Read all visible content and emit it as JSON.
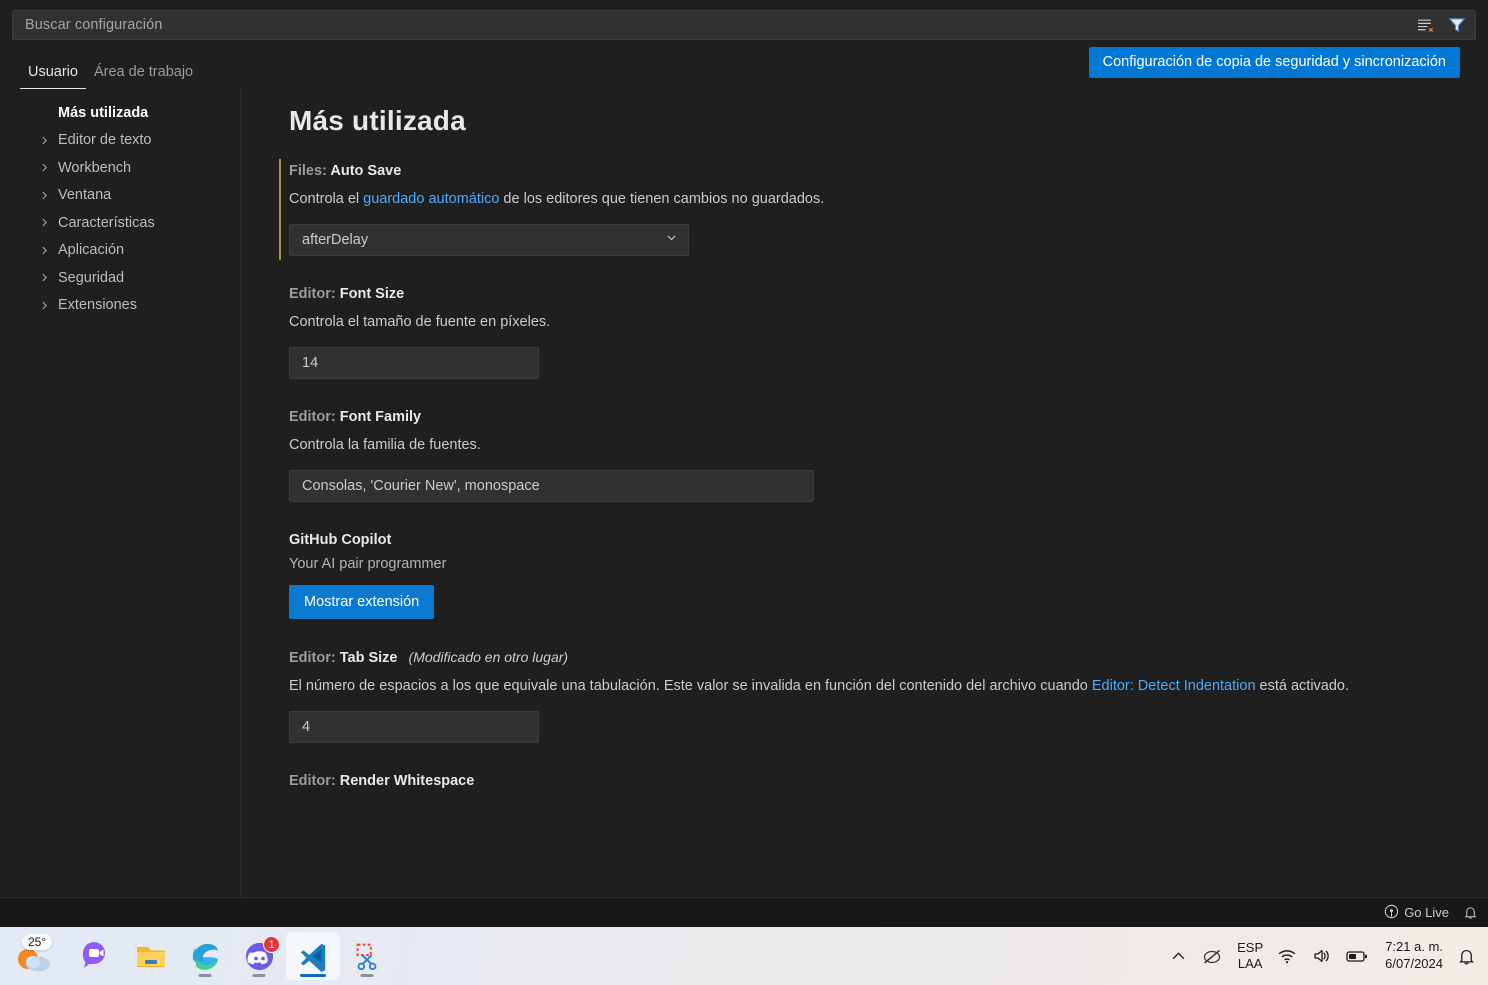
{
  "search": {
    "placeholder": "Buscar configuración",
    "clear_icon": "clear-search-results-icon",
    "filter_icon": "filter-icon"
  },
  "tabs": [
    {
      "label": "Usuario",
      "active": true
    },
    {
      "label": "Área de trabajo",
      "active": false
    }
  ],
  "sync_button": {
    "label": "Configuración de copia de seguridad y sincronización",
    "color": "#0078d4"
  },
  "sidebar": {
    "items": [
      {
        "label": "Más utilizada",
        "selected": true,
        "expandable": false
      },
      {
        "label": "Editor de texto",
        "selected": false,
        "expandable": true
      },
      {
        "label": "Workbench",
        "selected": false,
        "expandable": true
      },
      {
        "label": "Ventana",
        "selected": false,
        "expandable": true
      },
      {
        "label": "Características",
        "selected": false,
        "expandable": true
      },
      {
        "label": "Aplicación",
        "selected": false,
        "expandable": true
      },
      {
        "label": "Seguridad",
        "selected": false,
        "expandable": true
      },
      {
        "label": "Extensiones",
        "selected": false,
        "expandable": true
      }
    ]
  },
  "main": {
    "page_title": "Más utilizada",
    "modified_indicator_color": "#b58c3c",
    "settings": {
      "auto_save": {
        "category": "Files:",
        "key": "Auto Save",
        "desc_before": "Controla el ",
        "desc_link": "guardado automático",
        "desc_after": " de los editores que tienen cambios no guardados.",
        "value": "afterDelay",
        "modified": true
      },
      "font_size": {
        "category": "Editor:",
        "key": "Font Size",
        "desc": "Controla el tamaño de fuente en píxeles.",
        "value": "14"
      },
      "font_family": {
        "category": "Editor:",
        "key": "Font Family",
        "desc": "Controla la familia de fuentes.",
        "value": "Consolas, 'Courier New', monospace"
      },
      "copilot": {
        "title": "GitHub Copilot",
        "desc": "Your AI pair programmer",
        "button_label": "Mostrar extensión"
      },
      "tab_size": {
        "category": "Editor:",
        "key": "Tab Size",
        "note": "(Modificado en otro lugar)",
        "desc_before": "El número de espacios a los que equivale una tabulación. Este valor se invalida en función del contenido del archivo cuando ",
        "desc_link": "Editor: Detect Indentation",
        "desc_after": " está activado.",
        "value": "4"
      },
      "render_whitespace": {
        "category": "Editor:",
        "key": "Render Whitespace"
      }
    }
  },
  "statusbar": {
    "go_live": "Go Live",
    "bell_icon": "notifications-bell-icon",
    "broadcast_icon": "broadcast-icon"
  },
  "taskbar": {
    "weather": {
      "temperature": "25°",
      "icon": "weather-partly-cloudy-icon"
    },
    "apps": [
      {
        "name": "chat-icon",
        "running": false,
        "active": false
      },
      {
        "name": "file-explorer-icon",
        "running": false,
        "active": false
      },
      {
        "name": "microsoft-edge-icon",
        "running": true,
        "active": false
      },
      {
        "name": "discord-icon",
        "running": true,
        "active": false,
        "badge": "1"
      },
      {
        "name": "vscode-icon",
        "running": true,
        "active": true
      },
      {
        "name": "snipping-tool-icon",
        "running": true,
        "active": false
      }
    ],
    "tray": {
      "chevron_icon": "show-hidden-icons-chevron-up",
      "status_icon": "do-not-disturb-icon",
      "language_line1": "ESP",
      "language_line2": "LAA",
      "wifi_icon": "wifi-icon",
      "volume_icon": "volume-icon",
      "battery_icon": "battery-icon",
      "time": "7:21 a. m.",
      "date": "6/07/2024",
      "notification_icon": "notifications-bell-icon"
    }
  }
}
